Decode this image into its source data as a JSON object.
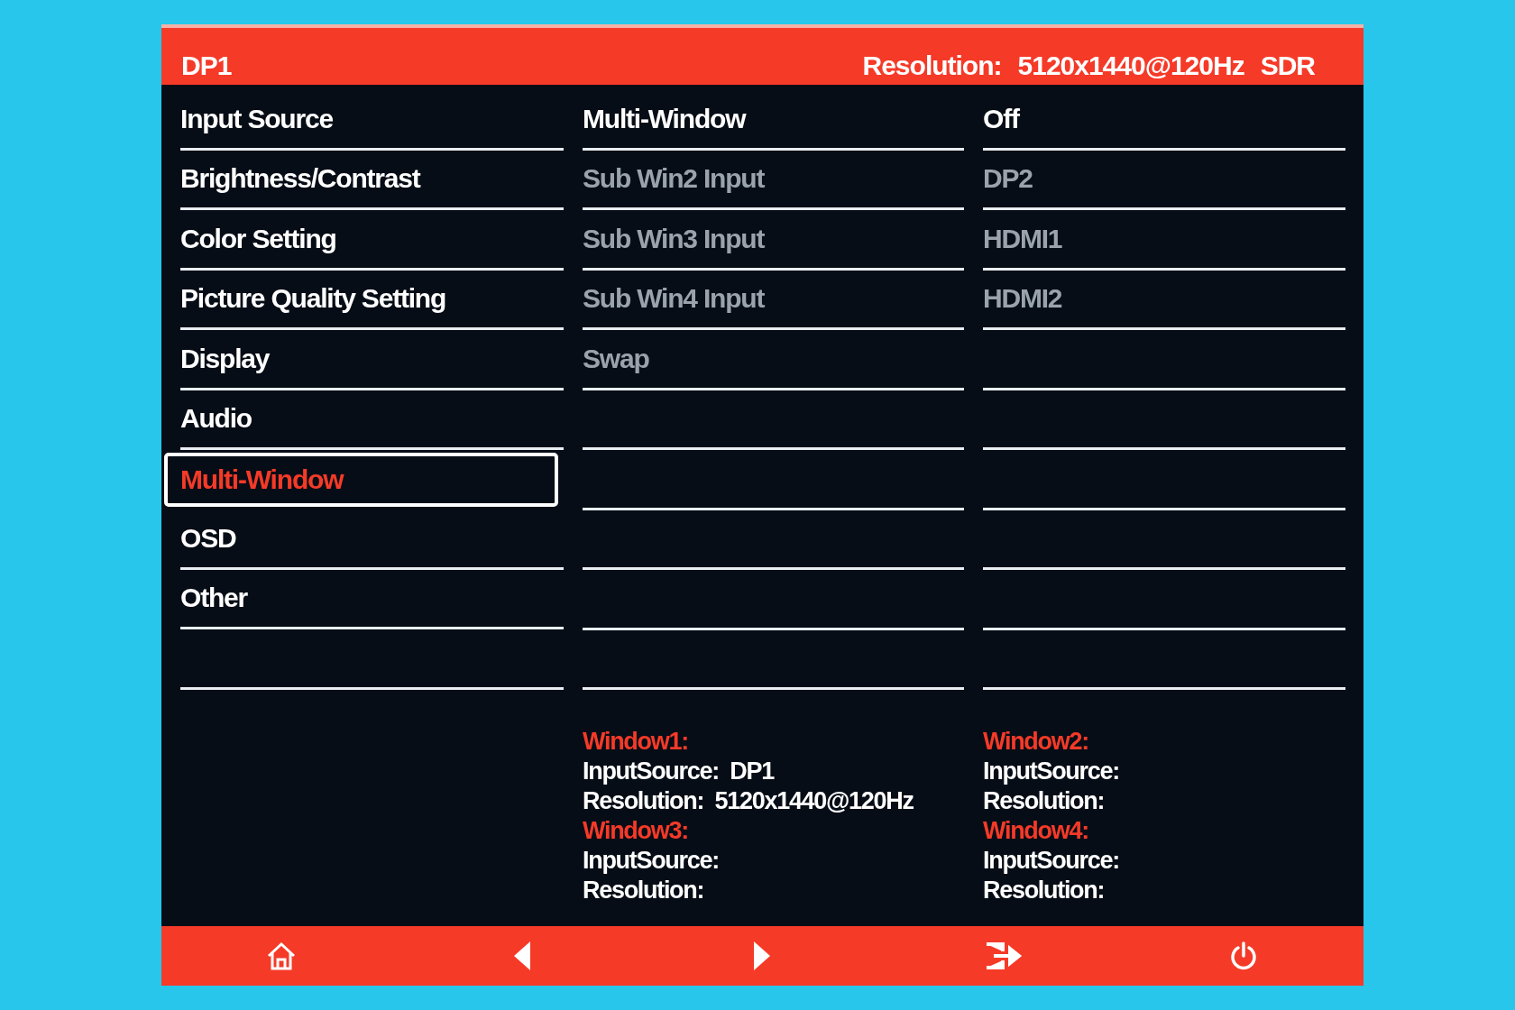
{
  "header": {
    "source": "DP1",
    "resolution_label": "Resolution:",
    "resolution_value": "5120x1440@120Hz",
    "dynamic_range": "SDR"
  },
  "menu": [
    {
      "label": "Input Source",
      "selected": false
    },
    {
      "label": "Brightness/Contrast",
      "selected": false
    },
    {
      "label": "Color Setting",
      "selected": false
    },
    {
      "label": "Picture Quality Setting",
      "selected": false
    },
    {
      "label": "Display",
      "selected": false
    },
    {
      "label": "Audio",
      "selected": false
    },
    {
      "label": "Multi-Window",
      "selected": true
    },
    {
      "label": "OSD",
      "selected": false
    },
    {
      "label": "Other",
      "selected": false
    }
  ],
  "submenu": [
    {
      "label": "Multi-Window",
      "value": "Off",
      "disabled": false
    },
    {
      "label": "Sub Win2 Input",
      "value": "DP2",
      "disabled": true
    },
    {
      "label": "Sub Win3 Input",
      "value": "HDMI1",
      "disabled": true
    },
    {
      "label": "Sub Win4 Input",
      "value": "HDMI2",
      "disabled": true
    },
    {
      "label": "Swap",
      "disabled": true
    }
  ],
  "windows": [
    {
      "title": "Window1:",
      "lines": [
        {
          "label": "InputSource:",
          "value": "DP1"
        },
        {
          "label": "Resolution:",
          "value": "5120x1440@120Hz"
        }
      ]
    },
    {
      "title": "Window2:",
      "lines": [
        {
          "label": "InputSource:"
        },
        {
          "label": "Resolution:"
        }
      ]
    },
    {
      "title": "Window3:",
      "lines": [
        {
          "label": "InputSource:"
        },
        {
          "label": "Resolution:"
        }
      ]
    },
    {
      "title": "Window4:",
      "lines": [
        {
          "label": "InputSource:"
        },
        {
          "label": "Resolution:"
        }
      ]
    }
  ]
}
